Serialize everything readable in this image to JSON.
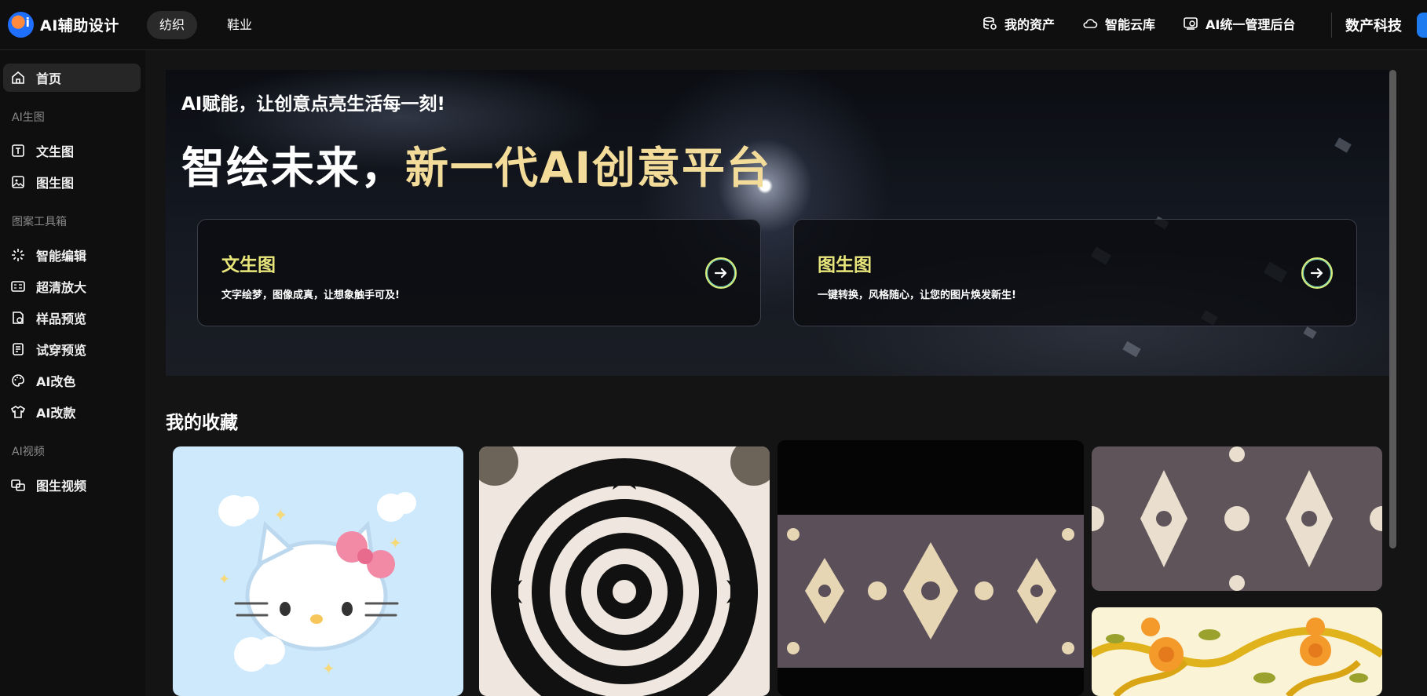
{
  "app": {
    "title": "AI辅助设计"
  },
  "header": {
    "categories": [
      {
        "label": "纺织",
        "active": true
      },
      {
        "label": "鞋业",
        "active": false
      }
    ],
    "links": [
      {
        "label": "我的资产",
        "icon": "database-icon"
      },
      {
        "label": "智能云库",
        "icon": "cloud-icon"
      },
      {
        "label": "AI统一管理后台",
        "icon": "admin-panel-icon"
      }
    ],
    "company": "数产科技"
  },
  "sidebar": {
    "home": "首页",
    "groups": [
      {
        "title": "AI生图",
        "items": [
          {
            "label": "文生图",
            "icon": "text-box-icon"
          },
          {
            "label": "图生图",
            "icon": "image-icon"
          }
        ]
      },
      {
        "title": "图案工具箱",
        "items": [
          {
            "label": "智能编辑",
            "icon": "sparkle-edit-icon"
          },
          {
            "label": "超清放大",
            "icon": "hd-upscale-icon"
          },
          {
            "label": "样品预览",
            "icon": "sample-preview-icon"
          },
          {
            "label": "试穿预览",
            "icon": "try-on-icon"
          },
          {
            "label": "AI改色",
            "icon": "palette-icon"
          },
          {
            "label": "AI改款",
            "icon": "shirt-icon"
          }
        ]
      },
      {
        "title": "AI视频",
        "items": [
          {
            "label": "图生视频",
            "icon": "video-icon"
          }
        ]
      }
    ]
  },
  "hero": {
    "subtitle": "AI赋能，让创意点亮生活每一刻!",
    "title_white": "智绘未来，",
    "title_gold": "新一代AI创意平台",
    "cards": [
      {
        "title": "文生图",
        "desc": "文字绘梦，图像成真，让想象触手可及!"
      },
      {
        "title": "图生图",
        "desc": "一键转换，风格随心，让您的图片焕发新生!"
      }
    ]
  },
  "favorites": {
    "title": "我的收藏",
    "items": [
      {
        "name": "hello-kitty-image"
      },
      {
        "name": "black-mandala-pattern"
      },
      {
        "name": "damask-tile-pattern"
      },
      {
        "name": "purple-damask-pattern"
      },
      {
        "name": "yellow-rose-pattern"
      }
    ]
  },
  "colors": {
    "accent_gold": "#f3dc9a",
    "card_title": "#e8e67a",
    "arrow_ring": "#d8f07a"
  }
}
